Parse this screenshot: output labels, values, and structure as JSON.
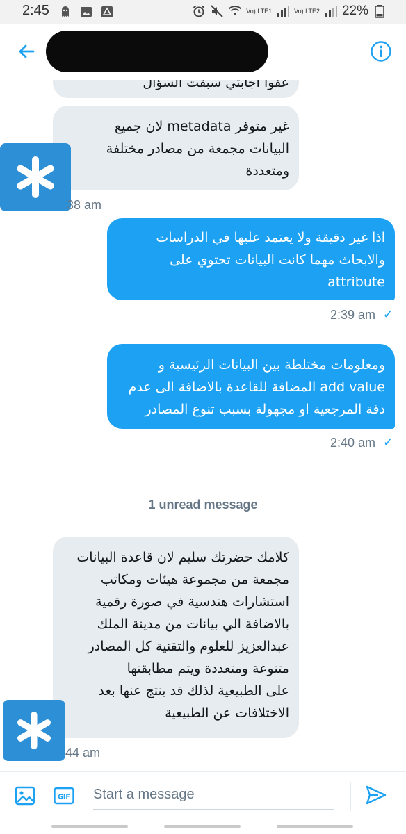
{
  "status_bar": {
    "time": "2:45",
    "battery": "22%",
    "sim1": "Vo) LTE1",
    "sim2": "Vo) LTE2",
    "icons": [
      "ghost-icon",
      "image-icon",
      "triangle-icon",
      "alarm-icon",
      "mute-icon",
      "wifi-icon",
      "signal-icon",
      "battery-icon"
    ]
  },
  "header": {
    "title": "",
    "back_icon": "back-arrow-icon",
    "info_icon": "info-icon",
    "accent": "#1da1f2"
  },
  "messages": [
    {
      "from": "them",
      "lines": [
        "عفوا اجابتي سبقت السؤال"
      ]
    },
    {
      "from": "them",
      "lines": [
        "غير متوفر metadata لان جميع",
        "البيانات مجمعة من مصادر مختلفة",
        "ومتعددة"
      ],
      "time": "38 am"
    },
    {
      "from": "me",
      "lines": [
        "اذا غير دقيقة ولا يعتمد عليها في الدراسات",
        "والابحاث مهما كانت البيانات تحتوي على",
        "attribute"
      ],
      "time": "2:39 am"
    },
    {
      "from": "me",
      "lines": [
        "ومعلومات مختلطة بين البيانات الرئيسية و",
        "add value المضافة للقاعدة بالاضافة الى عدم",
        "دقة المرجعية او مجهولة بسبب تنوع المصادر"
      ],
      "time": "2:40 am"
    },
    {
      "from": "them",
      "lines": [
        "كلامك حضرتك سليم لان قاعدة البيانات",
        "مجمعة من مجموعة هيئات ومكاتب",
        "استشارات هندسية في صورة رقمية",
        "بالاضافة الي بيانات من مدينة الملك",
        "عبدالعزيز للعلوم والتقنية كل المصادر",
        "متنوعة ومتعددة ويتم مطابقتها",
        "على الطبيعية لذلك قد ينتج عنها بعد",
        "الاختلافات عن الطبيعية"
      ],
      "time": "44 am"
    }
  ],
  "read_mark": "✓",
  "unread_divider": "1 unread message",
  "composer": {
    "placeholder": "Start a message",
    "media_icon": "image-icon",
    "gif_label": "GIF",
    "send_icon": "send-icon"
  },
  "colors": {
    "sent_bubble": "#1da1f2",
    "received_bubble": "#e6ecf0",
    "avatar": "#2d8fd5"
  }
}
